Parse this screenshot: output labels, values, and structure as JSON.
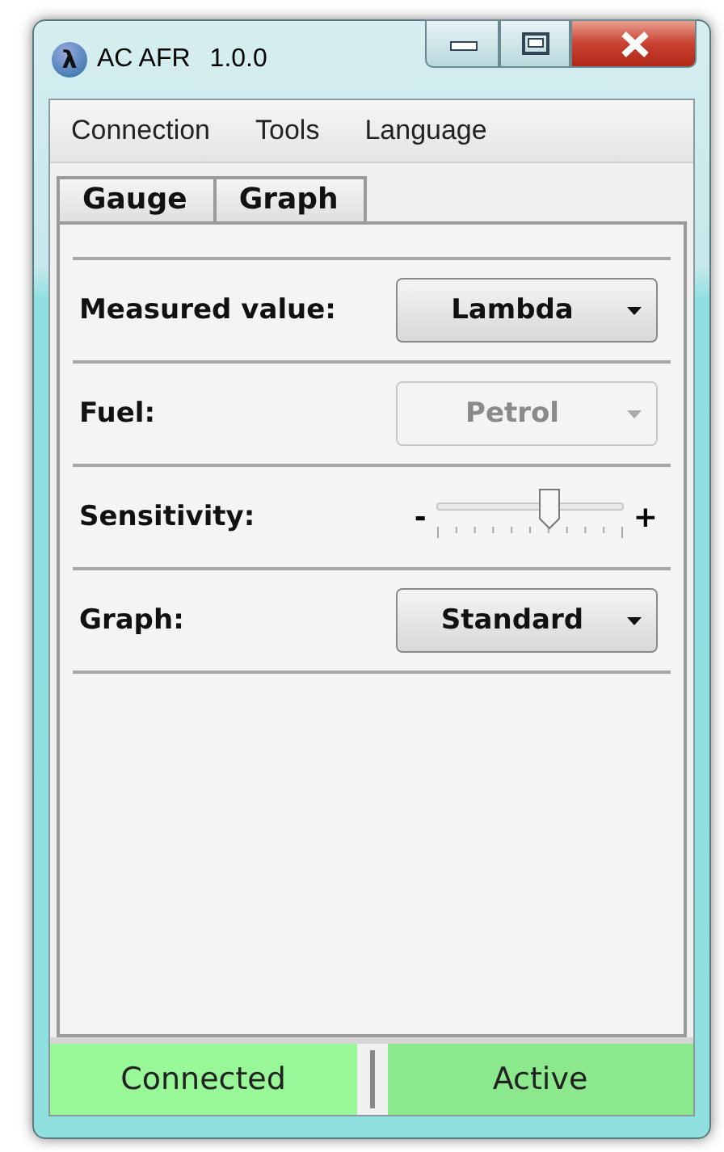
{
  "window": {
    "icon_glyph": "λ",
    "title": "AC AFR",
    "version": "1.0.0"
  },
  "menu": [
    "Connection",
    "Tools",
    "Language"
  ],
  "tabs": [
    {
      "label": "Gauge"
    },
    {
      "label": "Graph"
    }
  ],
  "settings": [
    {
      "kind": "dropdown",
      "label": "Measured value:",
      "value": "Lambda",
      "disabled": false
    },
    {
      "kind": "dropdown",
      "label": "Fuel:",
      "value": "Petrol",
      "disabled": true
    },
    {
      "kind": "slider",
      "label": "Sensitivity:",
      "min_label": "-",
      "max_label": "+",
      "level": 0.6
    },
    {
      "kind": "dropdown",
      "label": "Graph:",
      "value": "Standard",
      "disabled": false
    }
  ],
  "status_bar": [
    {
      "text": "Connected",
      "color": "#98f898"
    },
    {
      "text": "Active",
      "color": "#8ce88c"
    }
  ]
}
